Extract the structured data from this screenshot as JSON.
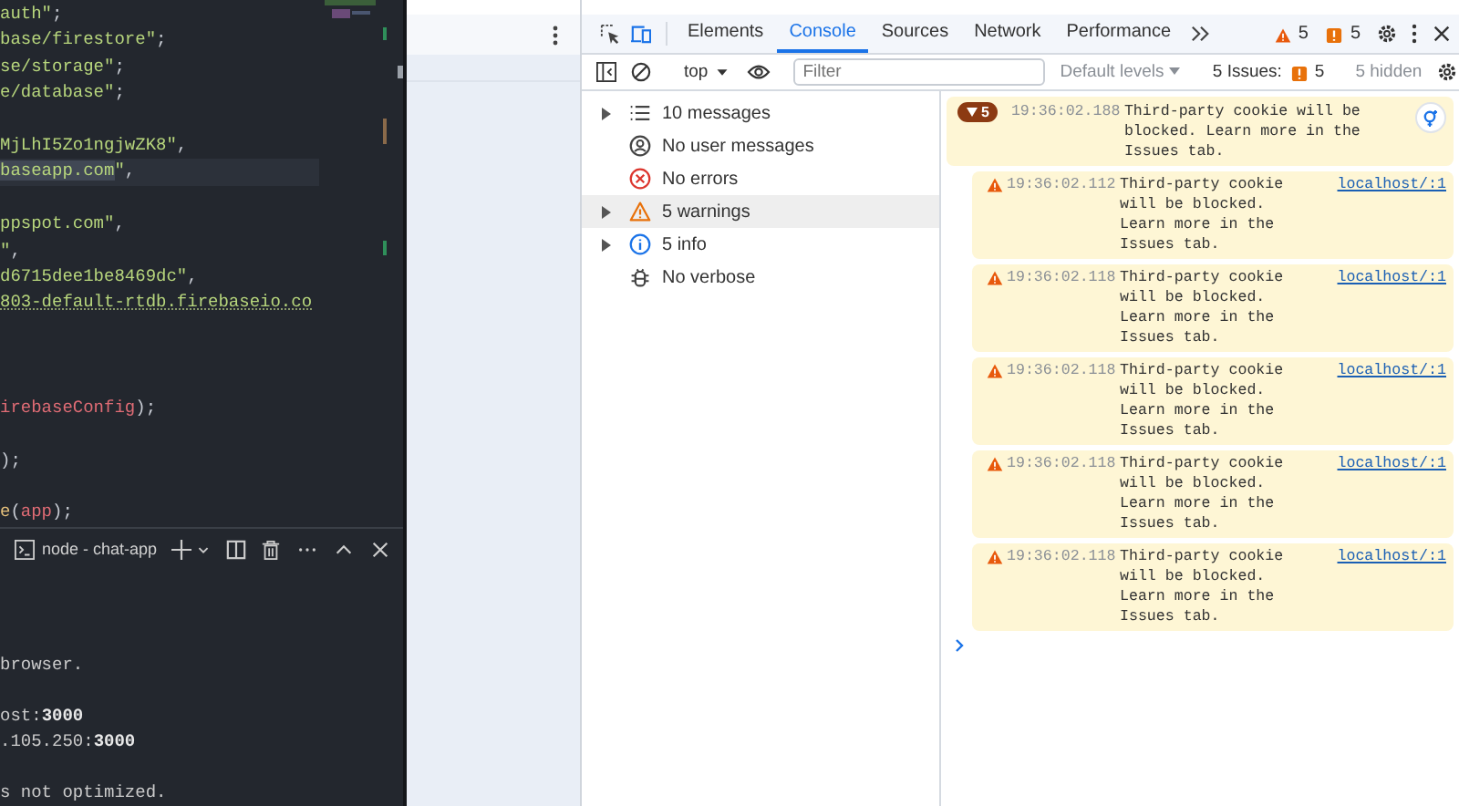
{
  "editor": {
    "lines": [
      {
        "kind": "code",
        "current": false,
        "segments": [
          {
            "text": "auth\"",
            "kind": "string"
          },
          {
            "text": ";",
            "kind": "punct"
          }
        ]
      },
      {
        "kind": "code",
        "current": false,
        "segments": [
          {
            "text": "base/firestore\"",
            "kind": "string"
          },
          {
            "text": ";",
            "kind": "punct"
          }
        ]
      },
      {
        "kind": "code",
        "current": false,
        "segments": [
          {
            "text": "se/storage\"",
            "kind": "string"
          },
          {
            "text": ";",
            "kind": "punct"
          }
        ]
      },
      {
        "kind": "code",
        "current": false,
        "segments": [
          {
            "text": "e/database\"",
            "kind": "string"
          },
          {
            "text": ";",
            "kind": "punct"
          }
        ]
      },
      {
        "kind": "blank",
        "current": false
      },
      {
        "kind": "code",
        "current": false,
        "segments": [
          {
            "text": "MjLhI5Zo1ngjwZK8\"",
            "kind": "string"
          },
          {
            "text": ",",
            "kind": "punct"
          }
        ]
      },
      {
        "kind": "code",
        "current": true,
        "segments": [
          {
            "text": "baseapp.com",
            "kind": "selection"
          },
          {
            "text": "\"",
            "kind": "string"
          },
          {
            "text": ",",
            "kind": "punct"
          }
        ]
      },
      {
        "kind": "blank",
        "current": false
      },
      {
        "kind": "code",
        "current": false,
        "segments": [
          {
            "text": "ppspot.com\"",
            "kind": "string"
          },
          {
            "text": ",",
            "kind": "punct"
          }
        ]
      },
      {
        "kind": "code",
        "current": false,
        "segments": [
          {
            "text": "\"",
            "kind": "string"
          },
          {
            "text": ",",
            "kind": "punct"
          }
        ]
      },
      {
        "kind": "code",
        "current": false,
        "segments": [
          {
            "text": "d6715dee1be8469dc\"",
            "kind": "string"
          },
          {
            "text": ",",
            "kind": "punct"
          }
        ]
      },
      {
        "kind": "code",
        "current": false,
        "segments": [
          {
            "text": "803-default-rtdb.firebaseio.co",
            "kind": "link"
          }
        ]
      },
      {
        "kind": "blank",
        "current": false
      },
      {
        "kind": "blank",
        "current": false
      },
      {
        "kind": "blank",
        "current": false
      },
      {
        "kind": "code",
        "current": false,
        "segments": [
          {
            "text": "irebaseConfig",
            "kind": "variable"
          },
          {
            "text": ");",
            "kind": "punct"
          }
        ]
      },
      {
        "kind": "blank",
        "current": false
      },
      {
        "kind": "code",
        "current": false,
        "segments": [
          {
            "text": ");",
            "kind": "punct"
          }
        ]
      },
      {
        "kind": "blank",
        "current": false
      },
      {
        "kind": "code",
        "current": false,
        "segments": [
          {
            "text": "e",
            "kind": "function"
          },
          {
            "text": "(",
            "kind": "punct"
          },
          {
            "text": "app",
            "kind": "variable"
          },
          {
            "text": ");",
            "kind": "punct"
          }
        ]
      }
    ]
  },
  "terminal": {
    "tab_title": "node - chat-app",
    "lines": [
      {
        "kind": "blank"
      },
      {
        "kind": "blank"
      },
      {
        "kind": "text",
        "text": "browser."
      },
      {
        "kind": "blank"
      },
      {
        "kind": "text",
        "text": "ost:**3000**"
      },
      {
        "kind": "text",
        "text": ".105.250:**3000**"
      },
      {
        "kind": "blank"
      },
      {
        "kind": "text",
        "text": "s not optimized."
      }
    ]
  },
  "devtools": {
    "tabs": [
      {
        "label": "Elements",
        "selected": false
      },
      {
        "label": "Console",
        "selected": true
      },
      {
        "label": "Sources",
        "selected": false
      },
      {
        "label": "Network",
        "selected": false
      },
      {
        "label": "Performance",
        "selected": false
      }
    ],
    "warning_count": "5",
    "issue_count": "5",
    "context": "top",
    "filter": {
      "placeholder": "Filter"
    },
    "levels": "Default levels",
    "issues_label": "5 Issues:",
    "issues_badge": "5",
    "hidden": "5 hidden",
    "sidebar": [
      {
        "label": "10 messages",
        "kind": "list",
        "expandable": true,
        "selected": false
      },
      {
        "label": "No user messages",
        "kind": "user",
        "expandable": false,
        "selected": false
      },
      {
        "label": "No errors",
        "kind": "error",
        "expandable": false,
        "selected": false
      },
      {
        "label": "5 warnings",
        "kind": "warning",
        "expandable": true,
        "selected": true
      },
      {
        "label": "5 info",
        "kind": "info",
        "expandable": true,
        "selected": false
      },
      {
        "label": "No verbose",
        "kind": "verbose",
        "expandable": false,
        "selected": false
      }
    ],
    "group": {
      "count": "5",
      "time": "19:36:02.188",
      "text": "Third-party cookie will be blocked. Learn more in the Issues tab."
    },
    "messages": [
      {
        "time": "19:36:02.112",
        "text": "Third-party cookie will be blocked. Learn more in the Issues tab.",
        "link": "localhost/:1"
      },
      {
        "time": "19:36:02.118",
        "text": "Third-party cookie will be blocked. Learn more in the Issues tab.",
        "link": "localhost/:1"
      },
      {
        "time": "19:36:02.118",
        "text": "Third-party cookie will be blocked. Learn more in the Issues tab.",
        "link": "localhost/:1"
      },
      {
        "time": "19:36:02.118",
        "text": "Third-party cookie will be blocked. Learn more in the Issues tab.",
        "link": "localhost/:1"
      },
      {
        "time": "19:36:02.118",
        "text": "Third-party cookie will be blocked. Learn more in the Issues tab.",
        "link": "localhost/:1"
      }
    ]
  }
}
